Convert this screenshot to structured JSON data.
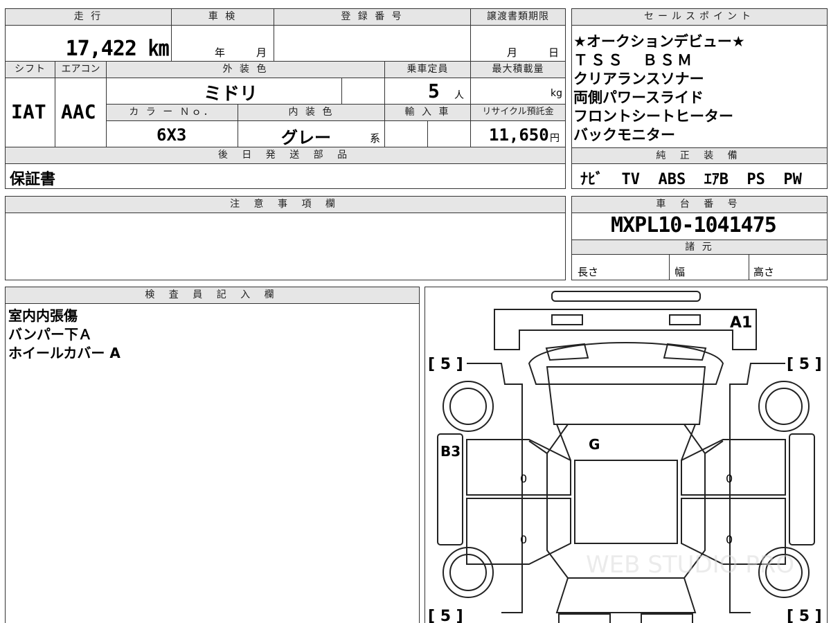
{
  "top_table": {
    "mileage_label": "走 行",
    "mileage_value": "17,422 ㎞",
    "inspection_label": "車 検",
    "inspection_year": "年",
    "inspection_month": "月",
    "registration_label": "登 録 番 号",
    "transfer_label": "譲渡書類期限",
    "transfer_month": "月",
    "transfer_day": "日",
    "shift_label": "シフト",
    "shift_value": "IAT",
    "aircon_label": "エアコン",
    "aircon_value": "AAC",
    "exterior_color_label": "外 装 色",
    "exterior_color_value": "ミドリ",
    "capacity_label": "乗車定員",
    "capacity_value": "5",
    "capacity_unit": "人",
    "max_load_label": "最大積載量",
    "max_load_unit": "kg",
    "color_no_label": "カ ラ ー Ｎｏ．",
    "color_no_value": "6X3",
    "interior_color_label": "内 装 色",
    "interior_color_value": "グレー",
    "interior_color_suffix": "系",
    "import_label": "輸 入 車",
    "recycle_label": "リサイクル預託金",
    "recycle_value": "11,650",
    "recycle_unit": "円",
    "later_parts_label": "後 日 発 送 部 品",
    "later_parts_value": "保証書"
  },
  "sales_points": {
    "label": "セールスポイント",
    "lines": [
      "★オークションデビュー★",
      "ＴＳＳ　ＢＳＭ",
      "クリアランスソナー",
      "両側パワースライド",
      "フロントシートヒーター",
      "バックモニター"
    ]
  },
  "genuine_equipment": {
    "label": "純 正 装 備",
    "value": "ﾅﾋﾞ  TV  ABS  ｴｱB  PS  PW"
  },
  "notes": {
    "label": "注 意 事 項 欄"
  },
  "chassis": {
    "label": "車 台 番 号",
    "value": "MXPL10-1041475",
    "spec_label": "諸 元",
    "length_label": "長さ",
    "width_label": "幅",
    "height_label": "高さ"
  },
  "inspector": {
    "label": "検 査 員 記 入 欄",
    "lines": [
      "室内内張傷",
      "バンパー下Ａ",
      "ホイールカバー A"
    ]
  },
  "diagram": {
    "marks": {
      "front_bumper": "A1",
      "left_front_door": "B3",
      "windshield": "G"
    },
    "tire_tread": [
      "[ 5 ]",
      "[ 5 ]",
      "[ 5 ]",
      "[ 5 ]"
    ],
    "door_zeros": [
      "0",
      "0",
      "0",
      "0"
    ],
    "watermark": "WEB STUDIO PRO"
  }
}
